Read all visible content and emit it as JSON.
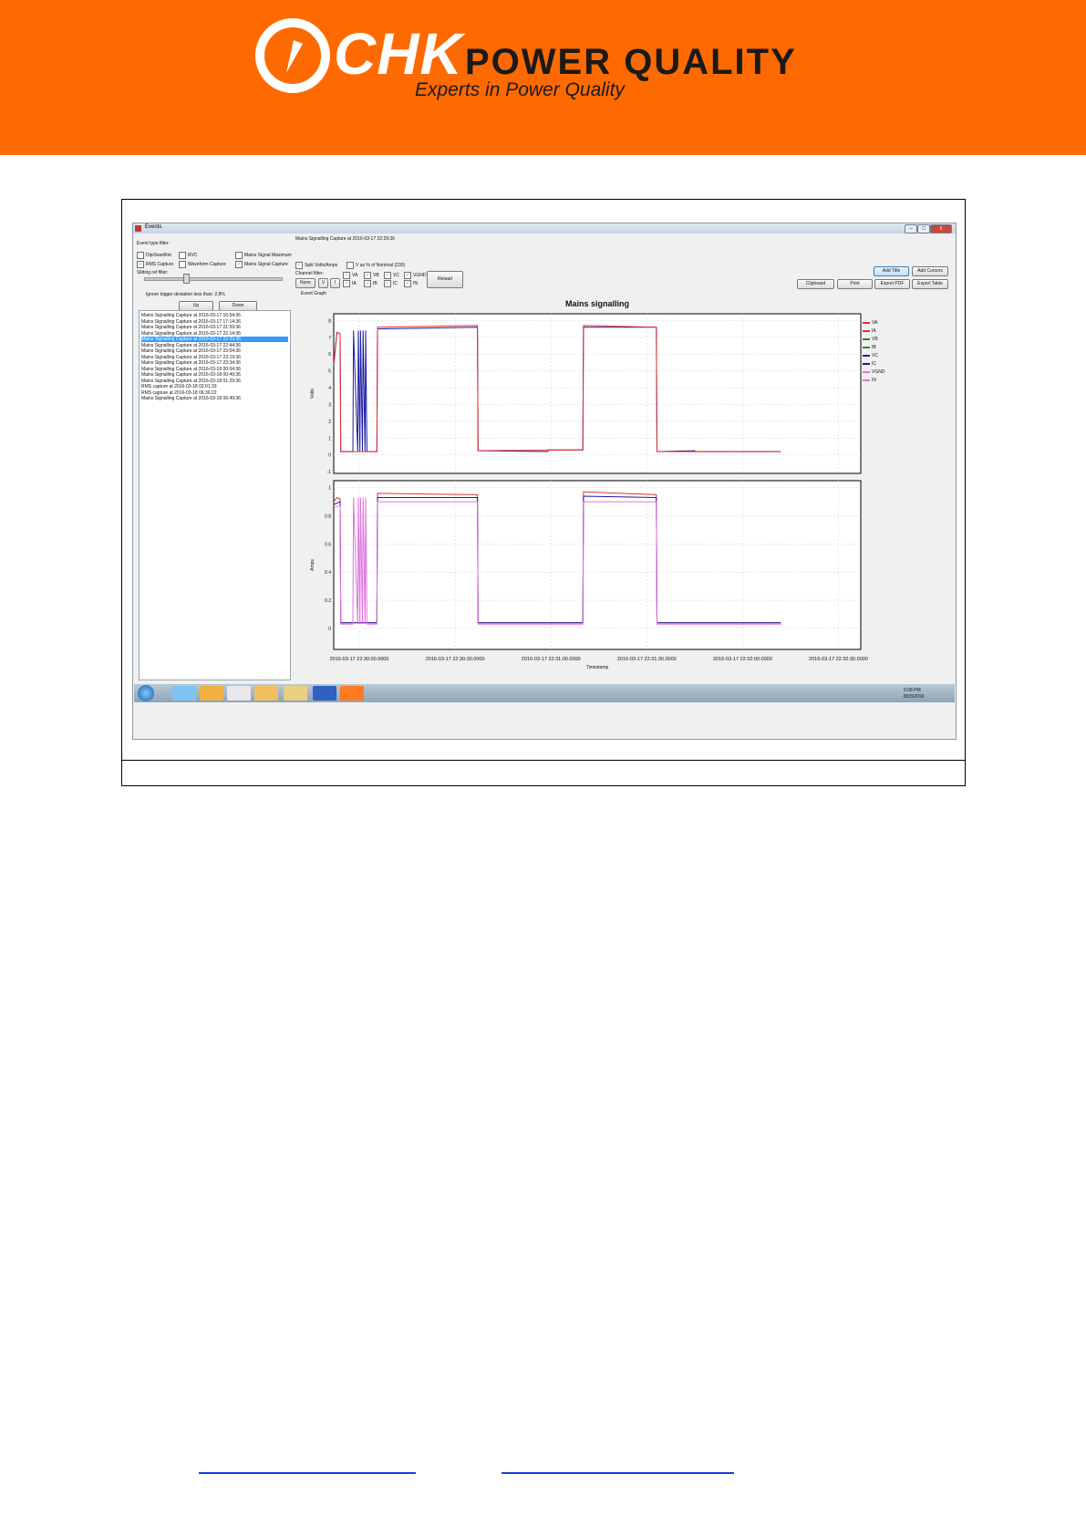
{
  "page": {
    "header_color": "#ff6a00"
  },
  "logo": {
    "chk": "CHK",
    "power_quality": "POWER QUALITY",
    "tagline": "Experts in Power Quality"
  },
  "window": {
    "title": "Events",
    "minimize": "–",
    "maximize": "□",
    "close": "x"
  },
  "filters": {
    "event_type_label": "Event type filter:",
    "options": [
      {
        "label": "Dip/Swell/Int",
        "checked": false
      },
      {
        "label": "RVC",
        "checked": false
      },
      {
        "label": "Mains Signal Maximum",
        "checked": false
      },
      {
        "label": "RMS Capture",
        "checked": true
      },
      {
        "label": "Waveform Capture",
        "checked": false
      },
      {
        "label": "Mains Signal Capture",
        "checked": true
      }
    ],
    "sliding_ref_label": "Sliding ref filter:",
    "ignore_trigger_label": "Ignore trigger deviation less than: 2.8%",
    "up_button": "Up",
    "down_button": "Down"
  },
  "events": [
    {
      "text": "Mains Signalling Capture at 2016-03-17 16:54:36",
      "selected": false
    },
    {
      "text": "Mains Signalling Capture at 2016-03-17 17:14:36",
      "selected": false
    },
    {
      "text": "Mains Signalling Capture at 2016-03-17 21:59:36",
      "selected": false
    },
    {
      "text": "Mains Signalling Capture at 2016-03-17 22:14:36",
      "selected": false
    },
    {
      "text": "Mains Signalling Capture at 2016-03-17 22:29:36",
      "selected": true
    },
    {
      "text": "Mains Signalling Capture at 2016-03-17 22:44:36",
      "selected": false
    },
    {
      "text": "Mains Signalling Capture at 2016-03-17 23:04:36",
      "selected": false
    },
    {
      "text": "Mains Signalling Capture at 2016-03-17 23:19:36",
      "selected": false
    },
    {
      "text": "Mains Signalling Capture at 2016-03-17 23:34:36",
      "selected": false
    },
    {
      "text": "Mains Signalling Capture at 2016-03-18 00:04:36",
      "selected": false
    },
    {
      "text": "Mains Signalling Capture at 2016-03-18 00:49:36",
      "selected": false
    },
    {
      "text": "Mains Signalling Capture at 2016-03-18 01:29:36",
      "selected": false
    },
    {
      "text": "RMS capture at 2016-03-18 02:01:33",
      "selected": false
    },
    {
      "text": "RMS capture at 2016-03-18 06:36:22",
      "selected": false
    },
    {
      "text": "Mains Signalling Capture at 2016-03-18 06:49:36",
      "selected": false
    }
  ],
  "capture_title": "Mains Signalling Capture at 2016-03-17 22:29:36",
  "options": {
    "split_volts_amps": {
      "label": "Split Volts/Amps",
      "checked": true
    },
    "v_as_percent": {
      "label": "V as % of Nominal (230)",
      "checked": false
    }
  },
  "channel_filter": {
    "label": "Channel filter:",
    "none_button": "None",
    "v_button": "V",
    "i_button": "I",
    "reload_button": "Reload",
    "channels": [
      {
        "label": "VA",
        "checked": true
      },
      {
        "label": "VB",
        "checked": true
      },
      {
        "label": "VC",
        "checked": true
      },
      {
        "label": "VGND",
        "checked": true
      },
      {
        "label": "IA",
        "checked": true
      },
      {
        "label": "IB",
        "checked": true
      },
      {
        "label": "IC",
        "checked": true
      },
      {
        "label": "IN",
        "checked": true
      }
    ]
  },
  "toolbar": {
    "add_title": "Add Title",
    "add_cursors": "Add Cursors",
    "clipboard": "Clipboard",
    "print": "Print",
    "export_pdf": "Export PDF",
    "export_table": "Export Table"
  },
  "event_graph_label": "Event Graph",
  "chart_data": {
    "type": "line",
    "title": "Mains signalling",
    "xlabel": "Timestamp",
    "x_ticks": [
      "2016-03-17 22:30:00.0000",
      "2016-03-17 22:30:30.0000",
      "2016-03-17 22:31:00.0000",
      "2016-03-17 22:31:30.0000",
      "2016-03-17 22:32:00.0000",
      "2016-03-17 22:32:30.0000"
    ],
    "xlim": [
      "2016-03-17 22:29:52",
      "2016-03-17 22:32:37"
    ],
    "legend": [
      "VA",
      "IA",
      "VB",
      "IB",
      "VC",
      "IC",
      "VGND",
      "IN"
    ],
    "legend_colors": [
      "#e03030",
      "#e03030",
      "#2a8a2a",
      "#2a8a2a",
      "#1a1aa0",
      "#1a1aa0",
      "#e070e0",
      "#e070e0"
    ],
    "legend_placement": "right",
    "grid": true,
    "panels": [
      {
        "ylabel": "Volts",
        "ylim": [
          -1.1,
          8.4
        ],
        "y_ticks": [
          "-1",
          "0",
          "1",
          "2",
          "3",
          "4",
          "5",
          "6",
          "7",
          "8"
        ],
        "series": [
          {
            "name": "VC",
            "color": "#1a1aa0",
            "x": [
              0,
              1,
              2,
              2.2,
              3,
              6,
              6.2,
              7.5,
              7.7,
              8.2,
              8.4,
              9,
              9.2,
              9.8,
              10,
              10.4,
              10.6,
              13.5,
              13.7,
              45,
              45.2,
              67,
              67.2,
              78,
              78.2,
              101,
              101.2,
              113,
              113.2,
              140
            ],
            "y": [
              5.3,
              7.3,
              7.2,
              0.2,
              0.2,
              0.2,
              7.4,
              0.2,
              7.4,
              0.2,
              7.4,
              0.2,
              7.4,
              0.2,
              7.4,
              0.2,
              0.2,
              0.2,
              7.5,
              7.6,
              0.25,
              0.2,
              0.3,
              0.3,
              7.6,
              7.6,
              0.2,
              0.25,
              0.2,
              0.2
            ]
          },
          {
            "name": "VA",
            "color": "#e03030",
            "x": [
              0,
              1,
              2,
              2.2,
              13.5,
              13.7,
              45,
              45.2,
              78,
              78.2,
              101,
              101.2,
              140
            ],
            "y": [
              5.4,
              7.3,
              7.2,
              0.2,
              0.2,
              7.6,
              7.7,
              0.25,
              0.3,
              7.7,
              7.6,
              0.2,
              0.2
            ]
          }
        ]
      },
      {
        "ylabel": "Amps",
        "ylim": [
          -0.15,
          1.05
        ],
        "y_ticks": [
          "0",
          "0.2",
          "0.4",
          "0.6",
          "0.8",
          "1"
        ],
        "series": [
          {
            "name": "IA",
            "color": "#e03030",
            "x": [
              0,
              1,
              2,
              2.2,
              13.5,
              13.7,
              45,
              45.2,
              78,
              78.2,
              101,
              101.2,
              140
            ],
            "y": [
              0.9,
              0.93,
              0.92,
              0.04,
              0.04,
              0.96,
              0.95,
              0.04,
              0.04,
              0.97,
              0.95,
              0.04,
              0.04
            ]
          },
          {
            "name": "IC",
            "color": "#1a1aa0",
            "x": [
              0,
              2,
              2.2,
              13.5,
              13.7,
              45,
              45.2,
              78,
              78.2,
              101,
              101.2,
              140
            ],
            "y": [
              0.88,
              0.9,
              0.04,
              0.04,
              0.93,
              0.93,
              0.04,
              0.04,
              0.94,
              0.93,
              0.04,
              0.04
            ]
          },
          {
            "name": "IN",
            "color": "#e070e0",
            "x": [
              0,
              2,
              2.2,
              6,
              6.2,
              7.5,
              7.7,
              8.2,
              8.4,
              9,
              9.2,
              9.8,
              10,
              10.4,
              10.6,
              13.5,
              13.7,
              45,
              45.2,
              78,
              78.2,
              101,
              101.2,
              140
            ],
            "y": [
              0.86,
              0.87,
              0.03,
              0.03,
              0.93,
              0.03,
              0.93,
              0.03,
              0.93,
              0.03,
              0.93,
              0.03,
              0.93,
              0.03,
              0.03,
              0.03,
              0.9,
              0.9,
              0.03,
              0.03,
              0.9,
              0.9,
              0.03,
              0.03
            ]
          }
        ]
      }
    ]
  },
  "taskbar": {
    "clock_time": "5:08 PM",
    "clock_date": "8/03/2016",
    "apps": [
      "ie-icon",
      "media-player-icon",
      "chrome-icon",
      "outlook-icon",
      "explorer-icon",
      "word-icon",
      "chk-app-icon"
    ]
  }
}
